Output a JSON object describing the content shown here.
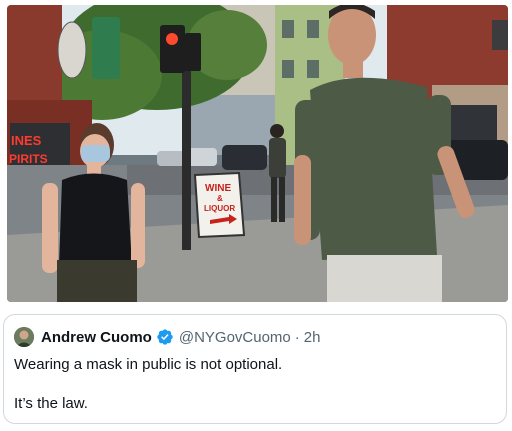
{
  "photo": {
    "sign_text_top": "WINE",
    "sign_text_mid": "&",
    "sign_text_bottom": "LIQUOR",
    "storefront_text_1": "INES",
    "storefront_text_2": "PIRITS"
  },
  "tweet": {
    "display_name": "Andrew Cuomo",
    "handle": "@NYGovCuomo",
    "separator": "·",
    "time": "2h",
    "line1": "Wearing a mask in public is not optional.",
    "line2": "It’s the law."
  },
  "colors": {
    "verified_blue": "#1d9bf0",
    "text_primary": "#0f1419",
    "text_secondary": "#536471",
    "border": "#cfd9de"
  }
}
